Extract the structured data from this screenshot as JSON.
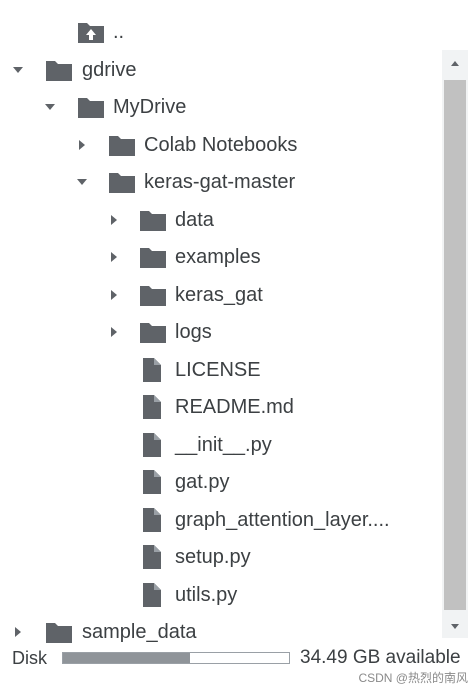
{
  "tree": [
    {
      "label": "..",
      "icon": "folder-up-icon",
      "chevron": "none",
      "depth": 1
    },
    {
      "label": "gdrive",
      "icon": "folder-icon",
      "chevron": "down",
      "depth": 0
    },
    {
      "label": "MyDrive",
      "icon": "folder-icon",
      "chevron": "down",
      "depth": 1
    },
    {
      "label": "Colab Notebooks",
      "icon": "folder-icon",
      "chevron": "right",
      "depth": 2
    },
    {
      "label": "keras-gat-master",
      "icon": "folder-icon",
      "chevron": "down",
      "depth": 2
    },
    {
      "label": "data",
      "icon": "folder-icon",
      "chevron": "right",
      "depth": 3
    },
    {
      "label": "examples",
      "icon": "folder-icon",
      "chevron": "right",
      "depth": 3
    },
    {
      "label": "keras_gat",
      "icon": "folder-icon",
      "chevron": "right",
      "depth": 3
    },
    {
      "label": "logs",
      "icon": "folder-icon",
      "chevron": "right",
      "depth": 3
    },
    {
      "label": "LICENSE",
      "icon": "file-icon",
      "chevron": "none",
      "depth": 3
    },
    {
      "label": "README.md",
      "icon": "file-icon",
      "chevron": "none",
      "depth": 3
    },
    {
      "label": "__init__.py",
      "icon": "file-icon",
      "chevron": "none",
      "depth": 3
    },
    {
      "label": "gat.py",
      "icon": "file-icon",
      "chevron": "none",
      "depth": 3
    },
    {
      "label": "graph_attention_layer....",
      "icon": "file-icon",
      "chevron": "none",
      "depth": 3
    },
    {
      "label": "setup.py",
      "icon": "file-icon",
      "chevron": "none",
      "depth": 3
    },
    {
      "label": "utils.py",
      "icon": "file-icon",
      "chevron": "none",
      "depth": 3
    },
    {
      "label": "sample_data",
      "icon": "folder-icon",
      "chevron": "right",
      "depth": 0
    }
  ],
  "disk": {
    "label": "Disk",
    "used_fraction": 0.56,
    "available_text": "34.49 GB available"
  },
  "watermark": "CSDN @热烈的南风",
  "colors": {
    "icon": "#5f6368",
    "text": "#3c4043",
    "scrollbar_thumb": "#c1c1c1",
    "disk_fill": "#8f9499"
  }
}
